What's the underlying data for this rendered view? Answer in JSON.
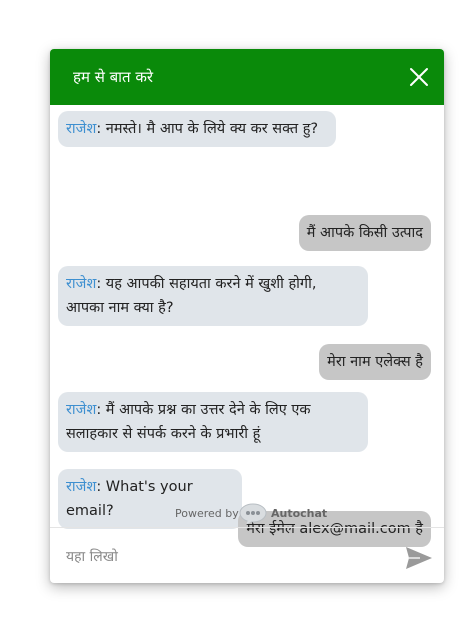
{
  "header": {
    "title": "हम से बात करे"
  },
  "messages": [
    {
      "sender": "राजेश",
      "text": ": नमस्ते। मै आप के लिये क्य कर सक्त हु?"
    },
    {
      "text": "मैं आपके किसी उत्पाद"
    },
    {
      "sender": "राजेश",
      "line1": ": यह आपकी सहायता करने में खुशी होगी,",
      "line2": "आपका नाम क्या है?"
    },
    {
      "text": "मेरा नाम एलेक्स है"
    },
    {
      "sender": "राजेश",
      "line1": ": मैं आपके प्रश्न का उत्तर देने के लिए एक",
      "line2": "सलाहकार से संपर्क करने के प्रभारी हूं"
    },
    {
      "sender": "राजेश",
      "text": ": What's your email?"
    },
    {
      "text": "मेरा ईमेल alex@mail.com है"
    }
  ],
  "footer": {
    "powered_by": "Powered by",
    "brand": "Autochat"
  },
  "composer": {
    "placeholder": "यहा लिखो"
  },
  "colors": {
    "header": "#0a8a0a",
    "bot_bubble": "#e0e5ea",
    "user_bubble": "#c6c6c6",
    "sender_name": "#3d8fd0"
  },
  "icons": {
    "close": "close-icon",
    "send": "send-icon",
    "brand_logo": "autochat-logo-icon"
  }
}
